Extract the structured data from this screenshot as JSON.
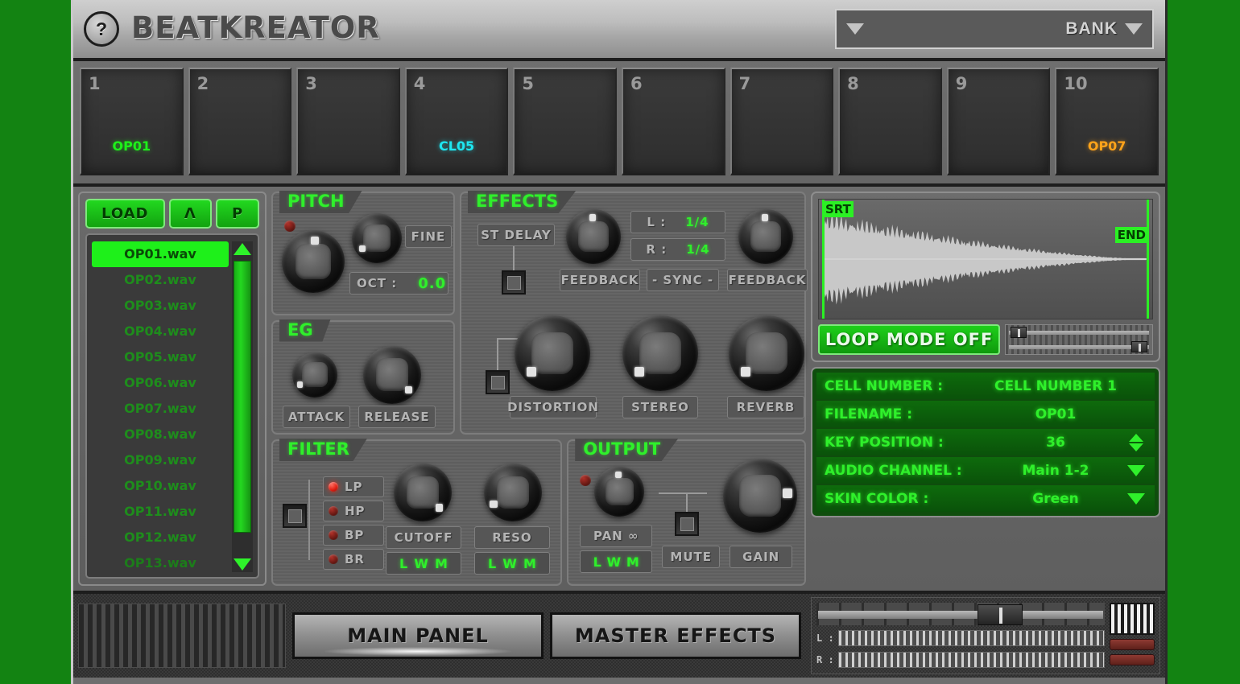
{
  "header": {
    "help_icon": "?",
    "title": "BEATKREATOR",
    "bank_label": "BANK"
  },
  "pads": [
    {
      "num": "1",
      "name": "OP01",
      "color": "#1ef01a"
    },
    {
      "num": "2",
      "name": "",
      "color": "#1ef01a"
    },
    {
      "num": "3",
      "name": "",
      "color": "#1ef01a"
    },
    {
      "num": "4",
      "name": "CL05",
      "color": "#1ee6f0"
    },
    {
      "num": "5",
      "name": "",
      "color": "#1ef01a"
    },
    {
      "num": "6",
      "name": "",
      "color": "#1ef01a"
    },
    {
      "num": "7",
      "name": "",
      "color": "#1ef01a"
    },
    {
      "num": "8",
      "name": "",
      "color": "#1ef01a"
    },
    {
      "num": "9",
      "name": "",
      "color": "#1ef01a"
    },
    {
      "num": "10",
      "name": "OP07",
      "color": "#ffa31a"
    }
  ],
  "browser": {
    "load_label": "LOAD",
    "up_label": "Λ",
    "p_label": "P",
    "selected_index": 0,
    "files": [
      "OP01.wav",
      "OP02.wav",
      "OP03.wav",
      "OP04.wav",
      "OP05.wav",
      "OP06.wav",
      "OP07.wav",
      "OP08.wav",
      "OP09.wav",
      "OP10.wav",
      "OP11.wav",
      "OP12.wav",
      "OP13.wav"
    ]
  },
  "pitch": {
    "title": "PITCH",
    "fine_label": "FINE",
    "oct_label": "OCT :",
    "oct_value": "0.0"
  },
  "eg": {
    "title": "EG",
    "attack_label": "ATTACK",
    "release_label": "RELEASE"
  },
  "effects": {
    "title": "EFFECTS",
    "st_delay_label": "ST DELAY",
    "l_label": "L :",
    "l_value": "1/4",
    "r_label": "R :",
    "r_value": "1/4",
    "feedback_left_label": "FEEDBACK",
    "sync_label": "- SYNC -",
    "feedback_right_label": "FEEDBACK",
    "distortion_label": "DISTORTION",
    "stereo_label": "STEREO",
    "reverb_label": "REVERB"
  },
  "filter": {
    "title": "FILTER",
    "modes": [
      {
        "label": "LP",
        "on": true
      },
      {
        "label": "HP",
        "on": false
      },
      {
        "label": "BP",
        "on": false
      },
      {
        "label": "BR",
        "on": false
      }
    ],
    "cutoff_label": "CUTOFF",
    "reso_label": "RESO",
    "lwm": [
      "L",
      "W",
      "M"
    ]
  },
  "output": {
    "title": "OUTPUT",
    "pan_label": "PAN ∞",
    "lwm": [
      "L",
      "W",
      "M"
    ],
    "mute_label": "MUTE",
    "gain_label": "GAIN"
  },
  "waveform": {
    "start_marker": "SRT",
    "end_marker": "END",
    "loop_mode_label": "LOOP MODE OFF"
  },
  "params": [
    {
      "key": "CELL NUMBER :",
      "value": "CELL NUMBER 1",
      "control": "none"
    },
    {
      "key": "FILENAME :",
      "value": "OP01",
      "control": "none"
    },
    {
      "key": "KEY POSITION :",
      "value": "36",
      "control": "spinner"
    },
    {
      "key": "AUDIO CHANNEL :",
      "value": "Main 1-2",
      "control": "dropdown"
    },
    {
      "key": "SKIN COLOR :",
      "value": "Green",
      "control": "dropdown"
    }
  ],
  "footer": {
    "main_panel_label": "MAIN PANEL",
    "master_effects_label": "MASTER EFFECTS",
    "vu_left_label": "L :",
    "vu_right_label": "R :"
  },
  "colors": {
    "background": "#138312",
    "accent_green": "#2ff02b",
    "panel_gray": "#656565"
  }
}
